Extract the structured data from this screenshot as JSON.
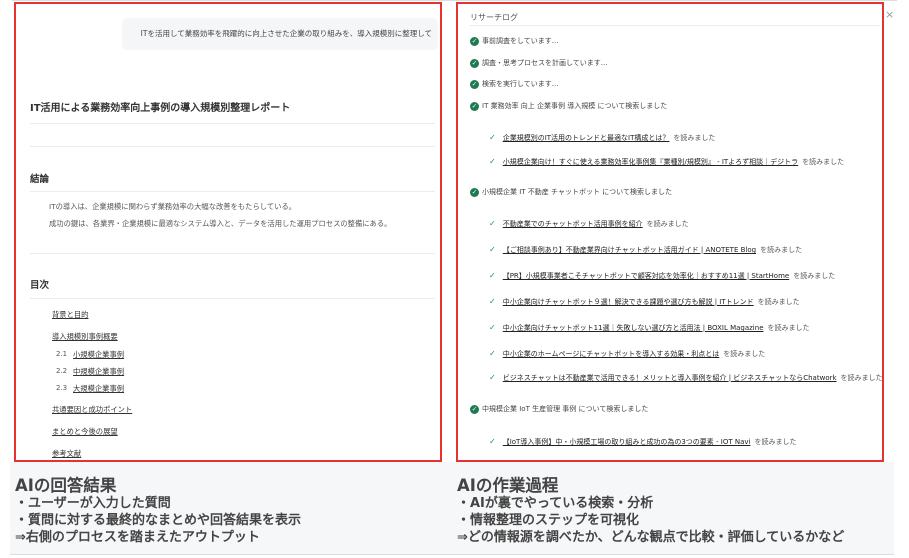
{
  "left": {
    "query": "ITを活用して業務効率を飛躍的に向上させた企業の取り組みを、導入規模別に整理して",
    "report_title": "IT活用による業務効率向上事例の導入規模別整理レポート",
    "conclusion_heading": "結論",
    "conclusion_lines": [
      "ITの導入は、企業規模に関わらず業務効率の大幅な改善をもたらしている。",
      "成功の鍵は、各業界・企業規模に最適なシステム導入と、データを活用した運用プロセスの整備にある。"
    ],
    "toc_heading": "目次",
    "toc": [
      {
        "num": "",
        "label": "背景と目的"
      },
      {
        "num": "",
        "label": "導入規模別事例概要"
      },
      {
        "num": "2.1",
        "label": "小規模企業事例"
      },
      {
        "num": "2.2",
        "label": "中規模企業事例"
      },
      {
        "num": "2.3",
        "label": "大規模企業事例"
      },
      {
        "num": "",
        "label": "共通要因と成功ポイント"
      },
      {
        "num": "",
        "label": "まとめと今後の展望"
      },
      {
        "num": "",
        "label": "参考文献"
      }
    ]
  },
  "right": {
    "title": "リサーチログ",
    "close": "×",
    "steps": [
      "事前調査をしています...",
      "調査・思考プロセスを計画しています...",
      "検索を実行しています...",
      "IT 業務効率 向上 企業事例 導入規模 について検索しました",
      "小規模企業 IT 不動産 チャットボット について検索しました",
      "中規模企業 IoT 生産管理 事例 について検索しました"
    ],
    "read_suffix": "を読みました",
    "reads": [
      "企業規模別のIT活用のトレンドと最適なIT構成とは？",
      "小規模企業向け！すぐに使える業務効率化事例集『業種別/規模別』 - ITよろず相談｜デジトラ",
      "不動産業でのチャットボット活用事例を紹介",
      "【ご相談事例あり】不動産業界向けチャットボット活用ガイド | ANOTETE Blog",
      "【PR】小規模事業者こそチャットボットで顧客対応を効率化｜おすすめ11選 | StartHome",
      "中小企業向けチャットボット９選！解決できる課題や選び方も解説 | ITトレンド",
      "中小企業向けチャットボット11選｜失敗しない選び方と活用法 | BOXIL Magazine",
      "中小企業のホームページにチャットボットを導入する効果・利点とは",
      "ビジネスチャットは不動産業で活用できる！メリットと導入事例を紹介 | ビジネスチャットならChatwork",
      "【IoT導入事例】中・小規模工場の取り組みと成功の為の3つの要素 - IOT Navi"
    ]
  },
  "annotations": {
    "left": {
      "title": "AIの回答結果",
      "lines": [
        "・ユーザーが入力した質問",
        "・質問に対する最終的なまとめや回答結果を表示",
        "⇒右側のプロセスを踏まえたアウトプット"
      ]
    },
    "right": {
      "title": "AIの作業過程",
      "lines": [
        "・AIが裏でやっている検索・分析",
        "・情報整理のステップを可視化",
        "⇒どの情報源を調べたか、どんな観点で比較・評価しているかなど"
      ]
    }
  },
  "colors": {
    "highlight_border": "#e8322e",
    "check": "#1f7a52"
  }
}
